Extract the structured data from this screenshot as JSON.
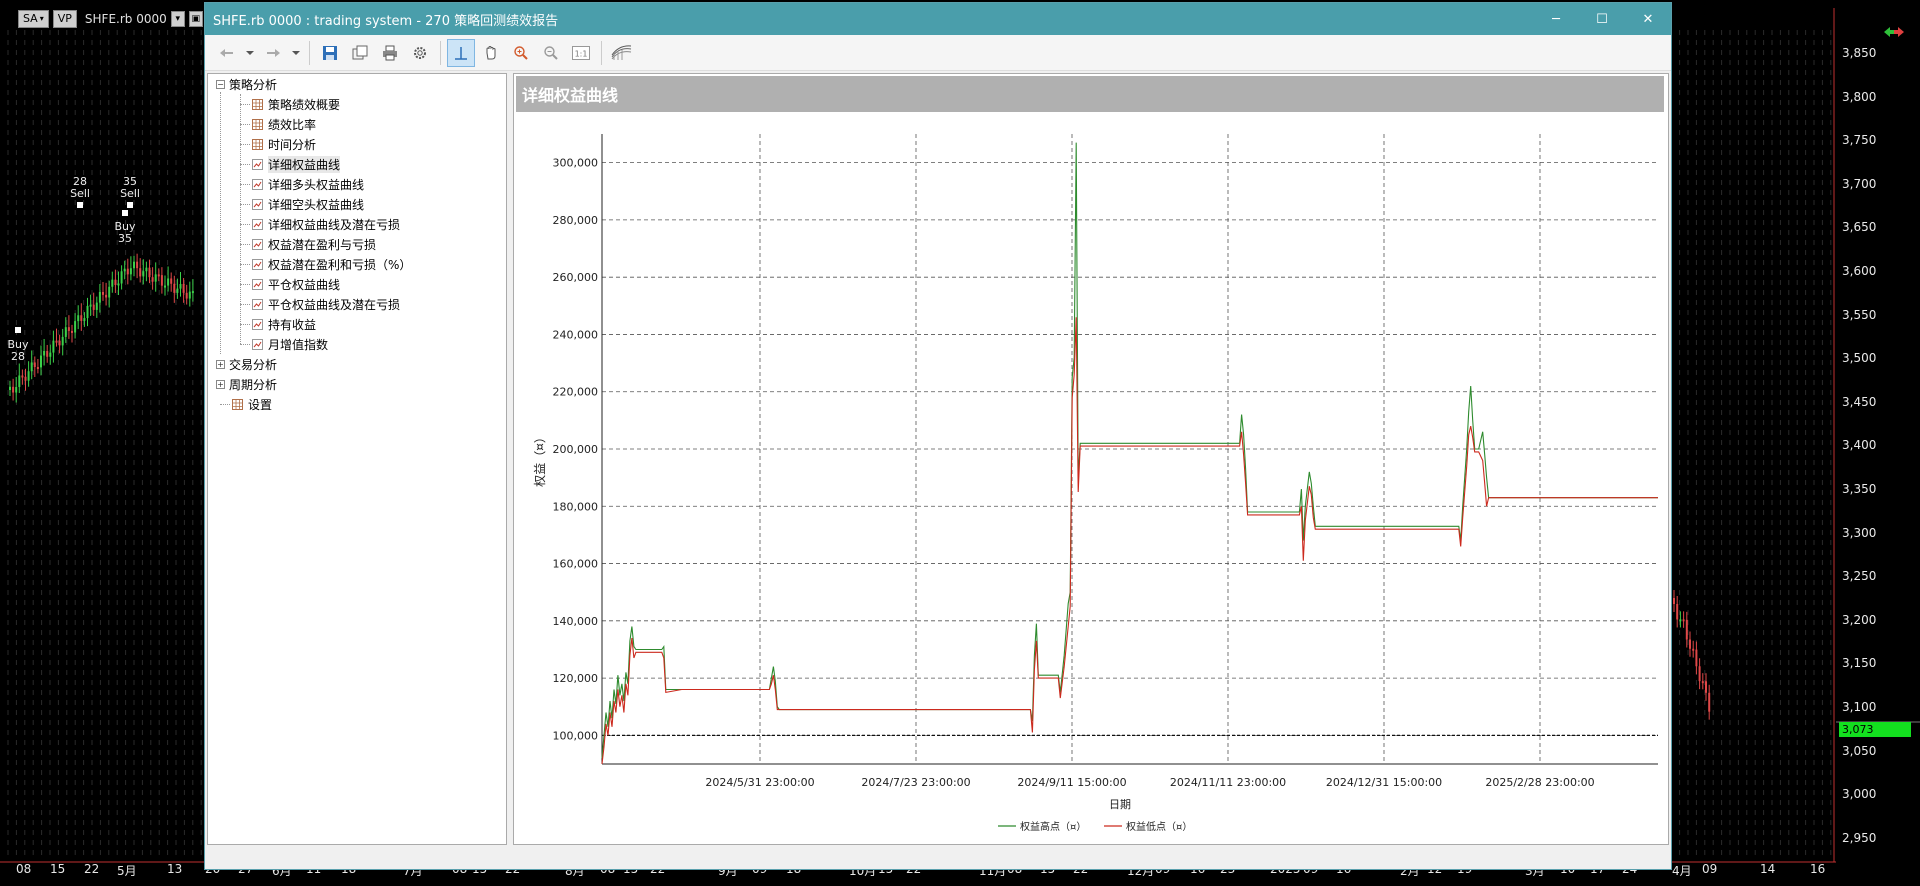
{
  "background": {
    "toolbar": {
      "badge1": "SA",
      "badge2": "VP",
      "symbol": "SHFE.rb 0000"
    },
    "price_ticks": [
      "3,850",
      "3,800",
      "3,750",
      "3,700",
      "3,650",
      "3,600",
      "3,550",
      "3,500",
      "3,450",
      "3,400",
      "3,350",
      "3,300",
      "3,250",
      "3,200",
      "3,150",
      "3,100",
      "3,050",
      "3,000",
      "2,950"
    ],
    "current_price": "3,073",
    "date_ticks": [
      "08",
      "15",
      "22",
      "5月",
      "13",
      "20",
      "27",
      "6月",
      "11",
      "18",
      "7月",
      "08",
      "15",
      "22",
      "8月",
      "08",
      "15",
      "22",
      "9月",
      "09",
      "18",
      "10月",
      "15",
      "22",
      "11月",
      "08",
      "15",
      "22",
      "12月",
      "09",
      "16",
      "23",
      "2025",
      "09",
      "16",
      "2月",
      "12",
      "19",
      "3月",
      "10",
      "17",
      "24",
      "4月",
      "09",
      "14",
      "16"
    ],
    "trade_labels": [
      "28",
      "Sell",
      "35",
      "Sell",
      "Buy",
      "35",
      "Buy",
      "28"
    ]
  },
  "window": {
    "title": "SHFE.rb 0000 : trading system - 270 策略回测绩效报告",
    "controls": {
      "minimize": "─",
      "maximize": "☐",
      "close": "✕"
    }
  },
  "tree": {
    "root1": "策略分析",
    "items": [
      "策略绩效概要",
      "绩效比率",
      "时间分析",
      "详细权益曲线",
      "详细多头权益曲线",
      "详细空头权益曲线",
      "详细权益曲线及潜在亏损",
      "权益潜在盈利与亏损",
      "权益潜在盈利和亏损（%）",
      "平仓权益曲线",
      "平仓权益曲线及潜在亏损",
      "持有收益",
      "月增值指数"
    ],
    "selected_index": 3,
    "root2": "交易分析",
    "root3": "周期分析",
    "settings": "设置"
  },
  "chart_header": "详细权益曲线",
  "chart_data": {
    "type": "line",
    "xlabel": "日期",
    "ylabel": "权益（¤）",
    "ylim": [
      90000,
      310000
    ],
    "yticks": [
      100000,
      120000,
      140000,
      160000,
      180000,
      200000,
      220000,
      240000,
      260000,
      280000,
      300000
    ],
    "ytick_labels": [
      "100,000",
      "120,000",
      "140,000",
      "160,000",
      "180,000",
      "200,000",
      "220,000",
      "240,000",
      "260,000",
      "280,000",
      "300,000"
    ],
    "xtick_labels": [
      "2024/5/31 23:00:00",
      "2024/7/23 23:00:00",
      "2024/9/11 15:00:00",
      "2024/11/11 23:00:00",
      "2024/12/31 15:00:00",
      "2025/2/28 23:00:00"
    ],
    "reference_line": 100000,
    "colors": {
      "high": "#2e8b2e",
      "low": "#cc2a1e",
      "grid": "#555555"
    },
    "series": [
      {
        "name": "权益高点（¤）",
        "points": [
          [
            0,
            92000
          ],
          [
            1,
            100000
          ],
          [
            2,
            108000
          ],
          [
            3,
            103000
          ],
          [
            4,
            112000
          ],
          [
            5,
            106000
          ],
          [
            6,
            116000
          ],
          [
            7,
            111000
          ],
          [
            8,
            121000
          ],
          [
            9,
            114000
          ],
          [
            10,
            118000
          ],
          [
            11,
            112000
          ],
          [
            12,
            122000
          ],
          [
            13,
            118000
          ],
          [
            14,
            133000
          ],
          [
            15,
            138000
          ],
          [
            16,
            131000
          ],
          [
            17,
            130000
          ],
          [
            20,
            130000
          ],
          [
            30,
            130000
          ],
          [
            31,
            131000
          ],
          [
            32,
            116000
          ],
          [
            40,
            116000
          ],
          [
            84,
            116000
          ],
          [
            85,
            120000
          ],
          [
            86,
            124000
          ],
          [
            87,
            119000
          ],
          [
            88,
            110000
          ],
          [
            89,
            109000
          ],
          [
            150,
            109000
          ],
          [
            215,
            109000
          ],
          [
            216,
            105000
          ],
          [
            217,
            128000
          ],
          [
            218,
            139000
          ],
          [
            219,
            121000
          ],
          [
            229,
            121000
          ],
          [
            230,
            115000
          ],
          [
            232,
            128000
          ],
          [
            234,
            146000
          ],
          [
            235,
            150000
          ],
          [
            236,
            225000
          ],
          [
            237,
            232000
          ],
          [
            238,
            307000
          ],
          [
            239,
            190000
          ],
          [
            240,
            202000
          ],
          [
            256,
            202000
          ],
          [
            320,
            202000
          ],
          [
            321,
            212000
          ],
          [
            322,
            205000
          ],
          [
            323,
            193000
          ],
          [
            324,
            178000
          ],
          [
            350,
            178000
          ],
          [
            351,
            186000
          ],
          [
            352,
            168000
          ],
          [
            353,
            180000
          ],
          [
            354,
            186000
          ],
          [
            355,
            192000
          ],
          [
            356,
            188000
          ],
          [
            357,
            180000
          ],
          [
            358,
            173000
          ],
          [
            430,
            173000
          ],
          [
            431,
            168000
          ],
          [
            432,
            180000
          ],
          [
            433,
            190000
          ],
          [
            434,
            200000
          ],
          [
            435,
            213000
          ],
          [
            436,
            222000
          ],
          [
            437,
            210000
          ],
          [
            438,
            200000
          ],
          [
            440,
            200000
          ],
          [
            442,
            206000
          ],
          [
            443,
            198000
          ],
          [
            444,
            190000
          ],
          [
            445,
            183000
          ],
          [
            530,
            183000
          ]
        ]
      },
      {
        "name": "权益低点（¤）",
        "points": [
          [
            0,
            90000
          ],
          [
            1,
            96000
          ],
          [
            2,
            104000
          ],
          [
            3,
            100000
          ],
          [
            4,
            108000
          ],
          [
            5,
            103000
          ],
          [
            6,
            112000
          ],
          [
            7,
            108000
          ],
          [
            8,
            116000
          ],
          [
            9,
            110000
          ],
          [
            10,
            114000
          ],
          [
            11,
            108000
          ],
          [
            12,
            118000
          ],
          [
            13,
            114000
          ],
          [
            14,
            128000
          ],
          [
            15,
            134000
          ],
          [
            16,
            127000
          ],
          [
            17,
            129000
          ],
          [
            20,
            129000
          ],
          [
            30,
            129000
          ],
          [
            31,
            127000
          ],
          [
            32,
            115000
          ],
          [
            40,
            116000
          ],
          [
            84,
            116000
          ],
          [
            85,
            118000
          ],
          [
            86,
            121000
          ],
          [
            87,
            116000
          ],
          [
            88,
            109000
          ],
          [
            89,
            109000
          ],
          [
            150,
            109000
          ],
          [
            215,
            109000
          ],
          [
            216,
            101000
          ],
          [
            217,
            123000
          ],
          [
            218,
            133000
          ],
          [
            219,
            120000
          ],
          [
            229,
            120000
          ],
          [
            230,
            113000
          ],
          [
            232,
            124000
          ],
          [
            234,
            138000
          ],
          [
            235,
            145000
          ],
          [
            236,
            218000
          ],
          [
            237,
            226000
          ],
          [
            238,
            246000
          ],
          [
            239,
            185000
          ],
          [
            240,
            201000
          ],
          [
            256,
            201000
          ],
          [
            320,
            201000
          ],
          [
            321,
            206000
          ],
          [
            322,
            198000
          ],
          [
            323,
            188000
          ],
          [
            324,
            177000
          ],
          [
            350,
            177000
          ],
          [
            351,
            180000
          ],
          [
            352,
            161000
          ],
          [
            353,
            175000
          ],
          [
            354,
            181000
          ],
          [
            355,
            187000
          ],
          [
            356,
            184000
          ],
          [
            357,
            176000
          ],
          [
            358,
            172000
          ],
          [
            430,
            172000
          ],
          [
            431,
            166000
          ],
          [
            432,
            176000
          ],
          [
            433,
            185000
          ],
          [
            434,
            194000
          ],
          [
            435,
            205000
          ],
          [
            436,
            208000
          ],
          [
            437,
            204000
          ],
          [
            438,
            199000
          ],
          [
            440,
            199000
          ],
          [
            442,
            196000
          ],
          [
            443,
            188000
          ],
          [
            444,
            180000
          ],
          [
            445,
            183000
          ],
          [
            530,
            183000
          ]
        ]
      }
    ]
  }
}
